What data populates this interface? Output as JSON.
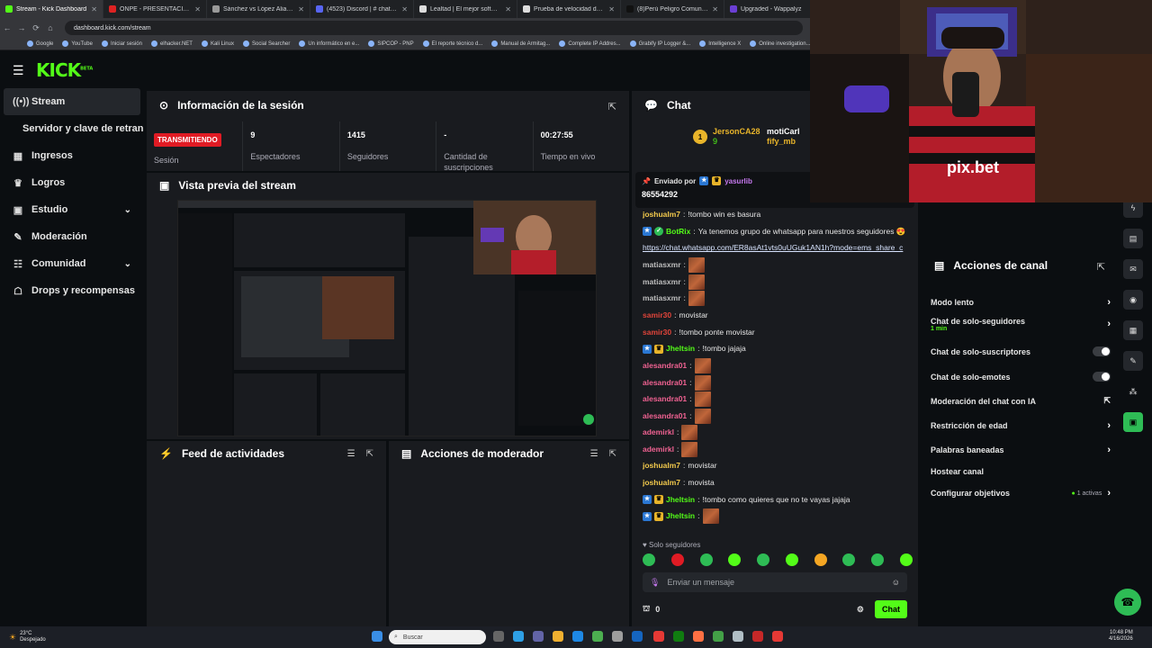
{
  "browser": {
    "tabs": [
      {
        "label": "Stream - Kick Dashboard",
        "color": "#53fc18"
      },
      {
        "label": "ONPE - PRESENTACIÓN DE R",
        "color": "#d22"
      },
      {
        "label": "Sánchez vs López Aliaga — p",
        "color": "#999"
      },
      {
        "label": "(4523) Discord | # chat-ge",
        "color": "#5865f2"
      },
      {
        "label": "Lealtad | El mejor software p",
        "color": "#ddd"
      },
      {
        "label": "Prueba de velocidad de Ookl",
        "color": "#ddd"
      },
      {
        "label": "(8)Perú Peligro Comunismo y",
        "color": "#111"
      },
      {
        "label": "Upgraded - Wappalyz",
        "color": "#6b3fd4"
      }
    ],
    "url": "dashboard.kick.com/stream",
    "bookmarks": [
      "Google",
      "YouTube",
      "Iniciar sesión",
      "elhacker.NET",
      "Kali Linux",
      "Social Searcher",
      "Un informático en e...",
      "SIPCOP - PNP",
      "El reporte técnico d...",
      "Manual de Armitag...",
      "Complete IP Addres...",
      "Grabify IP Logger &...",
      "Intelligence X",
      "Online investigation..."
    ]
  },
  "header": {
    "logo": "KICK",
    "logo_sup": "BETA",
    "menu_icon": "hamburger-icon"
  },
  "sidebar": {
    "items": [
      {
        "label": "Stream",
        "icon": "◉"
      },
      {
        "label": "Servidor y clave de retransmisión",
        "icon": ""
      },
      {
        "label": "Ingresos",
        "icon": "▦"
      },
      {
        "label": "Logros",
        "icon": "🏆"
      },
      {
        "label": "Estudio",
        "icon": "▣"
      },
      {
        "label": "Moderación",
        "icon": "🔧"
      },
      {
        "label": "Comunidad",
        "icon": "👥"
      },
      {
        "label": "Drops y recompensas",
        "icon": "🎁"
      }
    ]
  },
  "session": {
    "title": "Información de la sesión",
    "live_badge": "TRANSMITIENDO",
    "session_label": "Sesión",
    "stats": [
      {
        "value": "9",
        "label": "Espectadores"
      },
      {
        "value": "1415",
        "label": "Seguidores"
      },
      {
        "value": "-",
        "label": "Cantidad de suscripciones"
      },
      {
        "value": "00:27:55",
        "label": "Tiempo en vivo"
      }
    ]
  },
  "preview": {
    "title": "Vista previa del stream"
  },
  "feed": {
    "title": "Feed de actividades"
  },
  "modactions": {
    "title": "Acciones de moderador"
  },
  "chat": {
    "title": "Chat",
    "leader": {
      "name": "JersonCA28",
      "sub": "9",
      "rank": "1"
    },
    "leader2": {
      "name": "motiCarl",
      "sub": "fify_mb"
    },
    "pinned_label": "Enviado por",
    "pinned_user": "yasurlib",
    "pinned_text": "86554292",
    "messages": [
      {
        "user": "joshualm7",
        "color": "#f2c94c",
        "text": "!tombo win es basura",
        "emote": false,
        "badges": []
      },
      {
        "user": "BotRix",
        "color": "#53fc18",
        "text": "Ya tenemos grupo de whatsapp para nuestros seguidores 😍",
        "emote": false,
        "badges": [
          "blue",
          "green"
        ]
      },
      {
        "user": "",
        "color": "#fff",
        "text": "",
        "link": "https://chat.whatsapp.com/ER8asAt1vts0uUGuk1AN1h?mode=ems_share_c",
        "emote": false,
        "badges": []
      },
      {
        "user": "matiasxmr",
        "color": "#bdbdbd",
        "text": "",
        "emote": true,
        "badges": []
      },
      {
        "user": "matiasxmr",
        "color": "#bdbdbd",
        "text": "",
        "emote": true,
        "badges": []
      },
      {
        "user": "matiasxmr",
        "color": "#bdbdbd",
        "text": "",
        "emote": true,
        "badges": []
      },
      {
        "user": "samir30",
        "color": "#e0443a",
        "text": "movistar",
        "emote": false,
        "badges": []
      },
      {
        "user": "samir30",
        "color": "#e0443a",
        "text": "!tombo ponte movistar",
        "emote": false,
        "badges": []
      },
      {
        "user": "Jheltsin",
        "color": "#53fc18",
        "text": "!tombo jajaja",
        "emote": false,
        "badges": [
          "blue",
          "gold"
        ]
      },
      {
        "user": "alesandra01",
        "color": "#f06292",
        "text": "",
        "emote": true,
        "badges": []
      },
      {
        "user": "alesandra01",
        "color": "#f06292",
        "text": "",
        "emote": true,
        "badges": []
      },
      {
        "user": "alesandra01",
        "color": "#f06292",
        "text": "",
        "emote": true,
        "badges": []
      },
      {
        "user": "alesandra01",
        "color": "#f06292",
        "text": "",
        "emote": true,
        "badges": []
      },
      {
        "user": "ademirkl",
        "color": "#f06292",
        "text": "",
        "emote": true,
        "badges": []
      },
      {
        "user": "ademirkl",
        "color": "#f06292",
        "text": "",
        "emote": true,
        "badges": []
      },
      {
        "user": "joshualm7",
        "color": "#f2c94c",
        "text": "movistar",
        "emote": false,
        "badges": []
      },
      {
        "user": "joshualm7",
        "color": "#f2c94c",
        "text": "movista",
        "emote": false,
        "badges": []
      },
      {
        "user": "Jheltsin",
        "color": "#53fc18",
        "text": "!tombo como quieres que no te vayas jajaja",
        "emote": false,
        "badges": [
          "blue",
          "gold"
        ]
      },
      {
        "user": "Jheltsin",
        "color": "#53fc18",
        "text": "",
        "emote": true,
        "badges": [
          "blue",
          "gold"
        ]
      }
    ],
    "followers_only": "Solo seguidores",
    "input_placeholder": "Enviar un mensaje",
    "viewer_count": "0",
    "send_label": "Chat"
  },
  "actions": {
    "title": "Acciones de canal",
    "rows": [
      {
        "label": "Modo lento",
        "type": "chevron"
      },
      {
        "label": "Chat de solo-seguidores",
        "sub": "1 min",
        "type": "chevron"
      },
      {
        "label": "Chat de solo-suscriptores",
        "type": "toggle"
      },
      {
        "label": "Chat de solo-emotes",
        "type": "toggle"
      },
      {
        "label": "Moderación del chat con IA",
        "type": "link"
      },
      {
        "label": "Restricción de edad",
        "type": "chevron"
      },
      {
        "label": "Palabras baneadas",
        "type": "chevron"
      },
      {
        "label": "Hostear canal",
        "type": "none"
      },
      {
        "label": "Configurar objetivos",
        "extra": "1 activas",
        "type": "chevron"
      }
    ]
  },
  "taskbar": {
    "weather_temp": "23°C",
    "weather_desc": "Despejado",
    "search_placeholder": "Buscar",
    "time": "10:48 PM",
    "date": "4/16/2026"
  },
  "webcam": {
    "shirt_text": "pix.bet"
  },
  "colors": {
    "brand": "#53fc18",
    "live": "#e01b24",
    "panel": "#191b1f",
    "bg": "#0b0e11"
  }
}
